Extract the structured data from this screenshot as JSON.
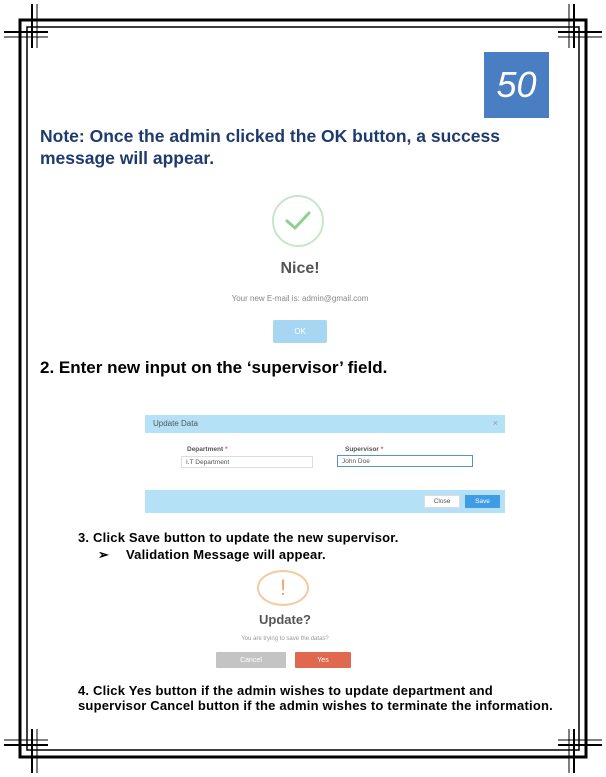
{
  "page_number": "50",
  "note": "Note: Once the admin clicked the OK button, a success message will appear.",
  "success_dialog": {
    "title": "Nice!",
    "message": "Your new E-mail is: admin@gmail.com",
    "ok_label": "OK"
  },
  "step2": "2. Enter new input on the ‘supervisor’ field.",
  "update_modal": {
    "title": "Update Data",
    "close_icon": "×",
    "department_label": "Department",
    "supervisor_label": "Supervisor",
    "required_mark": "*",
    "department_value": "I.T Department",
    "supervisor_value": "John Doe",
    "close_label": "Close",
    "save_label": "Save"
  },
  "step3": "3. Click Save button to update the new supervisor.",
  "step3_sub": "Validation Message will appear.",
  "step3_bullet": "➢",
  "confirm_dialog": {
    "title": "Update?",
    "message": "You are trying to save the datas?",
    "warn_glyph": "!",
    "cancel_label": "Cancel",
    "yes_label": "Yes"
  },
  "step4": "4. Click Yes button if the admin wishes to update department and supervisor Cancel button if the admin wishes to terminate the information.",
  "colors": {
    "page_badge": "#4a7ec2",
    "note_text": "#1f3b6e",
    "modal_bar": "#b5e1f7",
    "save_button": "#3f9de6",
    "yes_button": "#e0684f",
    "cancel_button": "#c4c4c4",
    "ok_button": "#a6d6f2"
  }
}
